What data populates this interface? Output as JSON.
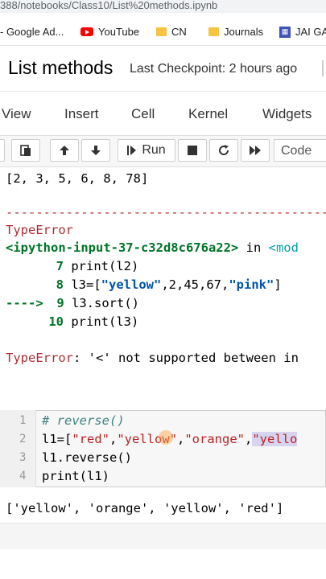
{
  "browser": {
    "url": "388/notebooks/Class10/List%20methods.ipynb",
    "bookmarks": [
      "- Google Ad...",
      "YouTube",
      "CN",
      "Journals",
      "JAI GA"
    ]
  },
  "notebook": {
    "title": "List methods",
    "checkpoint": "Last Checkpoint: 2 hours ago"
  },
  "menu": [
    "View",
    "Insert",
    "Cell",
    "Kernel",
    "Widgets"
  ],
  "toolbar": {
    "run_label": "Run",
    "cell_type": "Code"
  },
  "output1": {
    "list_line": "[2, 3, 5, 6, 8, 78]",
    "dashes": "---------------------------------------------",
    "error_name": "TypeError",
    "trace_location": "<ipython-input-37-c32d8c676a22>",
    "trace_in": " in ",
    "trace_module": "<mod",
    "line7_no": "7",
    "line7_code": "print(l2)",
    "line8_no": "8",
    "line8_code_a": "l3=[",
    "line8_str1": "\"yellow\"",
    "line8_mid": ",2,45,67,",
    "line8_str2": "\"pink\"",
    "line8_end": "]",
    "arrow": "---->",
    "line9_no": "9",
    "line9_code": "l3.sort()",
    "line10_no": "10",
    "line10_code": "print(l3)",
    "error_msg_name": "TypeError",
    "error_msg": ": '<' not supported between in"
  },
  "cell2": {
    "line_numbers": [
      "1",
      "2",
      "3",
      "4"
    ],
    "line1": "# reverse()",
    "line2_a": "l1=[",
    "line2_s1": "\"red\"",
    "line2_c1": ",",
    "line2_s2": "\"yellow\"",
    "line2_c2": ",",
    "line2_s3": "\"orange\"",
    "line2_c3": ",",
    "line2_s4": "\"yello",
    "line3": "l1.reverse()",
    "line4": "print(l1)"
  },
  "output2": "['yellow', 'orange', 'yellow', 'red']",
  "colors": {
    "error_red": "#b22b31",
    "trace_green": "#007427",
    "string_red": "#ba2121"
  }
}
